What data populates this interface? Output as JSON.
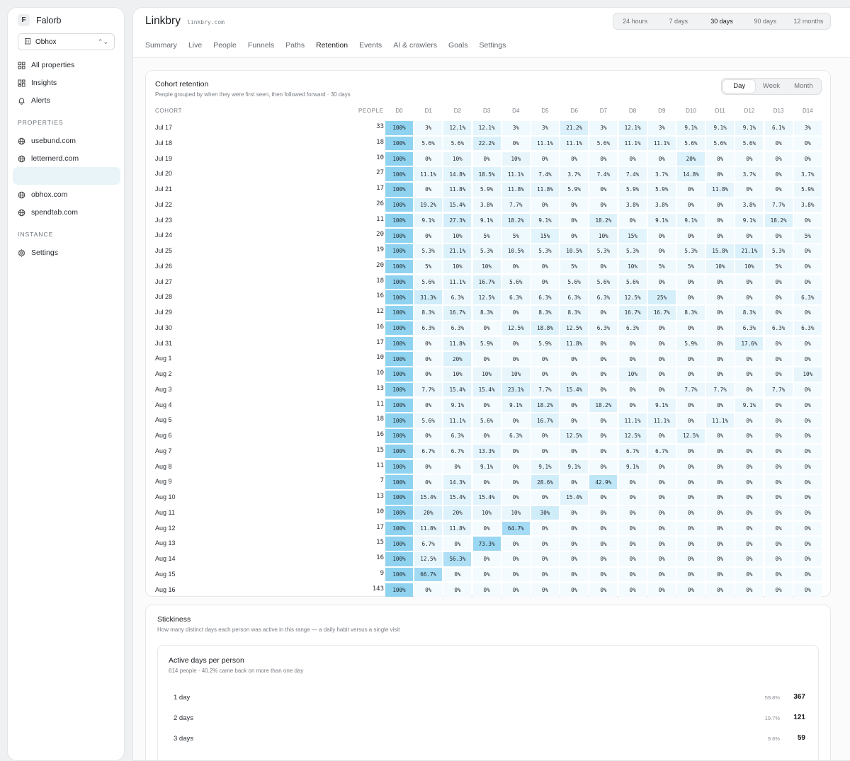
{
  "sidebar": {
    "brand_letter": "F",
    "brand_name": "Falorb",
    "project": "Obhox",
    "nav": [
      "All properties",
      "Insights",
      "Alerts"
    ],
    "properties_label": "PROPERTIES",
    "properties": [
      "usebund.com",
      "letternerd.com",
      "",
      "obhox.com",
      "spendtab.com"
    ],
    "instance_label": "INSTANCE",
    "instance": [
      "Settings"
    ]
  },
  "header": {
    "title": "Linkbry",
    "domain": "linkbry.com",
    "ranges": [
      "24 hours",
      "7 days",
      "30 days",
      "90 days",
      "12 months"
    ],
    "active_range": "30 days",
    "tabs": [
      "Summary",
      "Live",
      "People",
      "Funnels",
      "Paths",
      "Retention",
      "Events",
      "AI & crawlers",
      "Goals",
      "Settings"
    ],
    "active_tab": "Retention"
  },
  "cohort": {
    "title": "Cohort retention",
    "subtitle": "People grouped by when they were first seen, then followed forward · 30 days",
    "granularity": [
      "Day",
      "Week",
      "Month"
    ],
    "active_granularity": "Day",
    "col_cohort": "COHORT",
    "col_people": "PEOPLE",
    "days": [
      "D0",
      "D1",
      "D2",
      "D3",
      "D4",
      "D5",
      "D6",
      "D7",
      "D8",
      "D9",
      "D10",
      "D11",
      "D12",
      "D13",
      "D14"
    ],
    "rows": [
      {
        "date": "Jul 17",
        "people": "33",
        "vals": [
          "100%",
          "3%",
          "12.1%",
          "12.1%",
          "3%",
          "3%",
          "21.2%",
          "3%",
          "12.1%",
          "3%",
          "9.1%",
          "9.1%",
          "9.1%",
          "6.1%",
          "3%"
        ]
      },
      {
        "date": "Jul 18",
        "people": "18",
        "vals": [
          "100%",
          "5.6%",
          "5.6%",
          "22.2%",
          "0%",
          "11.1%",
          "11.1%",
          "5.6%",
          "11.1%",
          "11.1%",
          "5.6%",
          "5.6%",
          "5.6%",
          "0%",
          "0%"
        ]
      },
      {
        "date": "Jul 19",
        "people": "10",
        "vals": [
          "100%",
          "0%",
          "10%",
          "0%",
          "10%",
          "0%",
          "0%",
          "0%",
          "0%",
          "0%",
          "20%",
          "0%",
          "0%",
          "0%",
          "0%"
        ]
      },
      {
        "date": "Jul 20",
        "people": "27",
        "vals": [
          "100%",
          "11.1%",
          "14.8%",
          "18.5%",
          "11.1%",
          "7.4%",
          "3.7%",
          "7.4%",
          "7.4%",
          "3.7%",
          "14.8%",
          "0%",
          "3.7%",
          "0%",
          "3.7%"
        ]
      },
      {
        "date": "Jul 21",
        "people": "17",
        "vals": [
          "100%",
          "0%",
          "11.8%",
          "5.9%",
          "11.8%",
          "11.8%",
          "5.9%",
          "0%",
          "5.9%",
          "5.9%",
          "0%",
          "11.8%",
          "0%",
          "0%",
          "5.9%"
        ]
      },
      {
        "date": "Jul 22",
        "people": "26",
        "vals": [
          "100%",
          "19.2%",
          "15.4%",
          "3.8%",
          "7.7%",
          "0%",
          "0%",
          "0%",
          "3.8%",
          "3.8%",
          "0%",
          "0%",
          "3.8%",
          "7.7%",
          "3.8%"
        ]
      },
      {
        "date": "Jul 23",
        "people": "11",
        "vals": [
          "100%",
          "9.1%",
          "27.3%",
          "9.1%",
          "18.2%",
          "9.1%",
          "0%",
          "18.2%",
          "0%",
          "9.1%",
          "9.1%",
          "0%",
          "9.1%",
          "18.2%",
          "0%"
        ]
      },
      {
        "date": "Jul 24",
        "people": "20",
        "vals": [
          "100%",
          "0%",
          "10%",
          "5%",
          "5%",
          "15%",
          "0%",
          "10%",
          "15%",
          "0%",
          "0%",
          "0%",
          "0%",
          "0%",
          "5%"
        ]
      },
      {
        "date": "Jul 25",
        "people": "19",
        "vals": [
          "100%",
          "5.3%",
          "21.1%",
          "5.3%",
          "10.5%",
          "5.3%",
          "10.5%",
          "5.3%",
          "5.3%",
          "0%",
          "5.3%",
          "15.8%",
          "21.1%",
          "5.3%",
          "0%"
        ]
      },
      {
        "date": "Jul 26",
        "people": "20",
        "vals": [
          "100%",
          "5%",
          "10%",
          "10%",
          "0%",
          "0%",
          "5%",
          "0%",
          "10%",
          "5%",
          "5%",
          "10%",
          "10%",
          "5%",
          "0%"
        ]
      },
      {
        "date": "Jul 27",
        "people": "18",
        "vals": [
          "100%",
          "5.6%",
          "11.1%",
          "16.7%",
          "5.6%",
          "0%",
          "5.6%",
          "5.6%",
          "5.6%",
          "0%",
          "0%",
          "0%",
          "0%",
          "0%",
          "0%"
        ]
      },
      {
        "date": "Jul 28",
        "people": "16",
        "vals": [
          "100%",
          "31.3%",
          "6.3%",
          "12.5%",
          "6.3%",
          "6.3%",
          "6.3%",
          "6.3%",
          "12.5%",
          "25%",
          "0%",
          "0%",
          "0%",
          "0%",
          "6.3%"
        ]
      },
      {
        "date": "Jul 29",
        "people": "12",
        "vals": [
          "100%",
          "8.3%",
          "16.7%",
          "8.3%",
          "0%",
          "8.3%",
          "8.3%",
          "0%",
          "16.7%",
          "16.7%",
          "8.3%",
          "0%",
          "8.3%",
          "0%",
          "0%"
        ]
      },
      {
        "date": "Jul 30",
        "people": "16",
        "vals": [
          "100%",
          "6.3%",
          "6.3%",
          "0%",
          "12.5%",
          "18.8%",
          "12.5%",
          "6.3%",
          "6.3%",
          "0%",
          "0%",
          "0%",
          "6.3%",
          "6.3%",
          "6.3%"
        ]
      },
      {
        "date": "Jul 31",
        "people": "17",
        "vals": [
          "100%",
          "0%",
          "11.8%",
          "5.9%",
          "0%",
          "5.9%",
          "11.8%",
          "0%",
          "0%",
          "0%",
          "5.9%",
          "0%",
          "17.6%",
          "0%",
          "0%"
        ]
      },
      {
        "date": "Aug 1",
        "people": "10",
        "vals": [
          "100%",
          "0%",
          "20%",
          "0%",
          "0%",
          "0%",
          "0%",
          "0%",
          "0%",
          "0%",
          "0%",
          "0%",
          "0%",
          "0%",
          "0%"
        ]
      },
      {
        "date": "Aug 2",
        "people": "10",
        "vals": [
          "100%",
          "0%",
          "10%",
          "10%",
          "10%",
          "0%",
          "0%",
          "0%",
          "10%",
          "0%",
          "0%",
          "0%",
          "0%",
          "0%",
          "10%"
        ]
      },
      {
        "date": "Aug 3",
        "people": "13",
        "vals": [
          "100%",
          "7.7%",
          "15.4%",
          "15.4%",
          "23.1%",
          "7.7%",
          "15.4%",
          "0%",
          "0%",
          "0%",
          "7.7%",
          "7.7%",
          "0%",
          "7.7%",
          "0%"
        ]
      },
      {
        "date": "Aug 4",
        "people": "11",
        "vals": [
          "100%",
          "0%",
          "9.1%",
          "0%",
          "9.1%",
          "18.2%",
          "0%",
          "18.2%",
          "0%",
          "9.1%",
          "0%",
          "0%",
          "9.1%",
          "0%",
          "0%"
        ]
      },
      {
        "date": "Aug 5",
        "people": "18",
        "vals": [
          "100%",
          "5.6%",
          "11.1%",
          "5.6%",
          "0%",
          "16.7%",
          "0%",
          "0%",
          "11.1%",
          "11.1%",
          "0%",
          "11.1%",
          "0%",
          "0%",
          "0%"
        ]
      },
      {
        "date": "Aug 6",
        "people": "16",
        "vals": [
          "100%",
          "0%",
          "6.3%",
          "0%",
          "6.3%",
          "0%",
          "12.5%",
          "0%",
          "12.5%",
          "0%",
          "12.5%",
          "0%",
          "0%",
          "0%",
          "0%"
        ]
      },
      {
        "date": "Aug 7",
        "people": "15",
        "vals": [
          "100%",
          "6.7%",
          "6.7%",
          "13.3%",
          "0%",
          "0%",
          "0%",
          "0%",
          "6.7%",
          "6.7%",
          "0%",
          "0%",
          "0%",
          "0%",
          "0%"
        ]
      },
      {
        "date": "Aug 8",
        "people": "11",
        "vals": [
          "100%",
          "0%",
          "0%",
          "9.1%",
          "0%",
          "9.1%",
          "9.1%",
          "0%",
          "9.1%",
          "0%",
          "0%",
          "0%",
          "0%",
          "0%",
          "0%"
        ]
      },
      {
        "date": "Aug 9",
        "people": "7",
        "vals": [
          "100%",
          "0%",
          "14.3%",
          "0%",
          "0%",
          "28.6%",
          "0%",
          "42.9%",
          "0%",
          "0%",
          "0%",
          "0%",
          "0%",
          "0%",
          "0%"
        ]
      },
      {
        "date": "Aug 10",
        "people": "13",
        "vals": [
          "100%",
          "15.4%",
          "15.4%",
          "15.4%",
          "0%",
          "0%",
          "15.4%",
          "0%",
          "0%",
          "0%",
          "0%",
          "0%",
          "0%",
          "0%",
          "0%"
        ]
      },
      {
        "date": "Aug 11",
        "people": "10",
        "vals": [
          "100%",
          "20%",
          "20%",
          "10%",
          "10%",
          "30%",
          "0%",
          "0%",
          "0%",
          "0%",
          "0%",
          "0%",
          "0%",
          "0%",
          "0%"
        ]
      },
      {
        "date": "Aug 12",
        "people": "17",
        "vals": [
          "100%",
          "11.8%",
          "11.8%",
          "0%",
          "64.7%",
          "0%",
          "0%",
          "0%",
          "0%",
          "0%",
          "0%",
          "0%",
          "0%",
          "0%",
          "0%"
        ]
      },
      {
        "date": "Aug 13",
        "people": "15",
        "vals": [
          "100%",
          "6.7%",
          "0%",
          "73.3%",
          "0%",
          "0%",
          "0%",
          "0%",
          "0%",
          "0%",
          "0%",
          "0%",
          "0%",
          "0%",
          "0%"
        ]
      },
      {
        "date": "Aug 14",
        "people": "16",
        "vals": [
          "100%",
          "12.5%",
          "56.3%",
          "0%",
          "0%",
          "0%",
          "0%",
          "0%",
          "0%",
          "0%",
          "0%",
          "0%",
          "0%",
          "0%",
          "0%"
        ]
      },
      {
        "date": "Aug 15",
        "people": "9",
        "vals": [
          "100%",
          "66.7%",
          "0%",
          "0%",
          "0%",
          "0%",
          "0%",
          "0%",
          "0%",
          "0%",
          "0%",
          "0%",
          "0%",
          "0%",
          "0%"
        ]
      },
      {
        "date": "Aug 16",
        "people": "143",
        "vals": [
          "100%",
          "0%",
          "0%",
          "0%",
          "0%",
          "0%",
          "0%",
          "0%",
          "0%",
          "0%",
          "0%",
          "0%",
          "0%",
          "0%",
          "0%"
        ]
      }
    ]
  },
  "stickiness": {
    "title": "Stickiness",
    "subtitle": "How many distinct days each person was active in this range — a daily habit versus a single visit",
    "inner_title": "Active days per person",
    "inner_sub": "614 people · 40.2% came back on more than one day",
    "rows": [
      {
        "label": "1 day",
        "pct": "59.8%",
        "count": "367"
      },
      {
        "label": "2 days",
        "pct": "19.7%",
        "count": "121"
      },
      {
        "label": "3 days",
        "pct": "9.6%",
        "count": "59"
      }
    ]
  },
  "colors": {
    "accent": "#8fd3f0",
    "heat_low": "#f4fbfe",
    "heat_high": "#8fd3f0"
  }
}
